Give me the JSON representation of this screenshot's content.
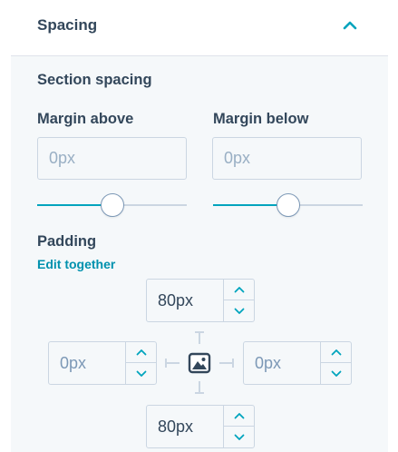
{
  "header": {
    "title": "Spacing",
    "collapse_icon": "chevron-up-icon"
  },
  "section": {
    "title": "Section spacing",
    "margin_above": {
      "label": "Margin above",
      "placeholder": "0px",
      "slider_fraction": 0.5
    },
    "margin_below": {
      "label": "Margin below",
      "placeholder": "0px",
      "slider_fraction": 0.5
    }
  },
  "padding": {
    "label": "Padding",
    "edit_together": "Edit together",
    "top": {
      "value": "80px"
    },
    "left": {
      "placeholder": "0px"
    },
    "right": {
      "placeholder": "0px"
    },
    "bottom": {
      "value": "80px"
    },
    "center_icon": "image-icon"
  },
  "colors": {
    "accent": "#00a4bd",
    "link": "#0091ae",
    "text": "#33475b",
    "border": "#cbd6e2",
    "panel_bg": "#f5f8fa"
  }
}
